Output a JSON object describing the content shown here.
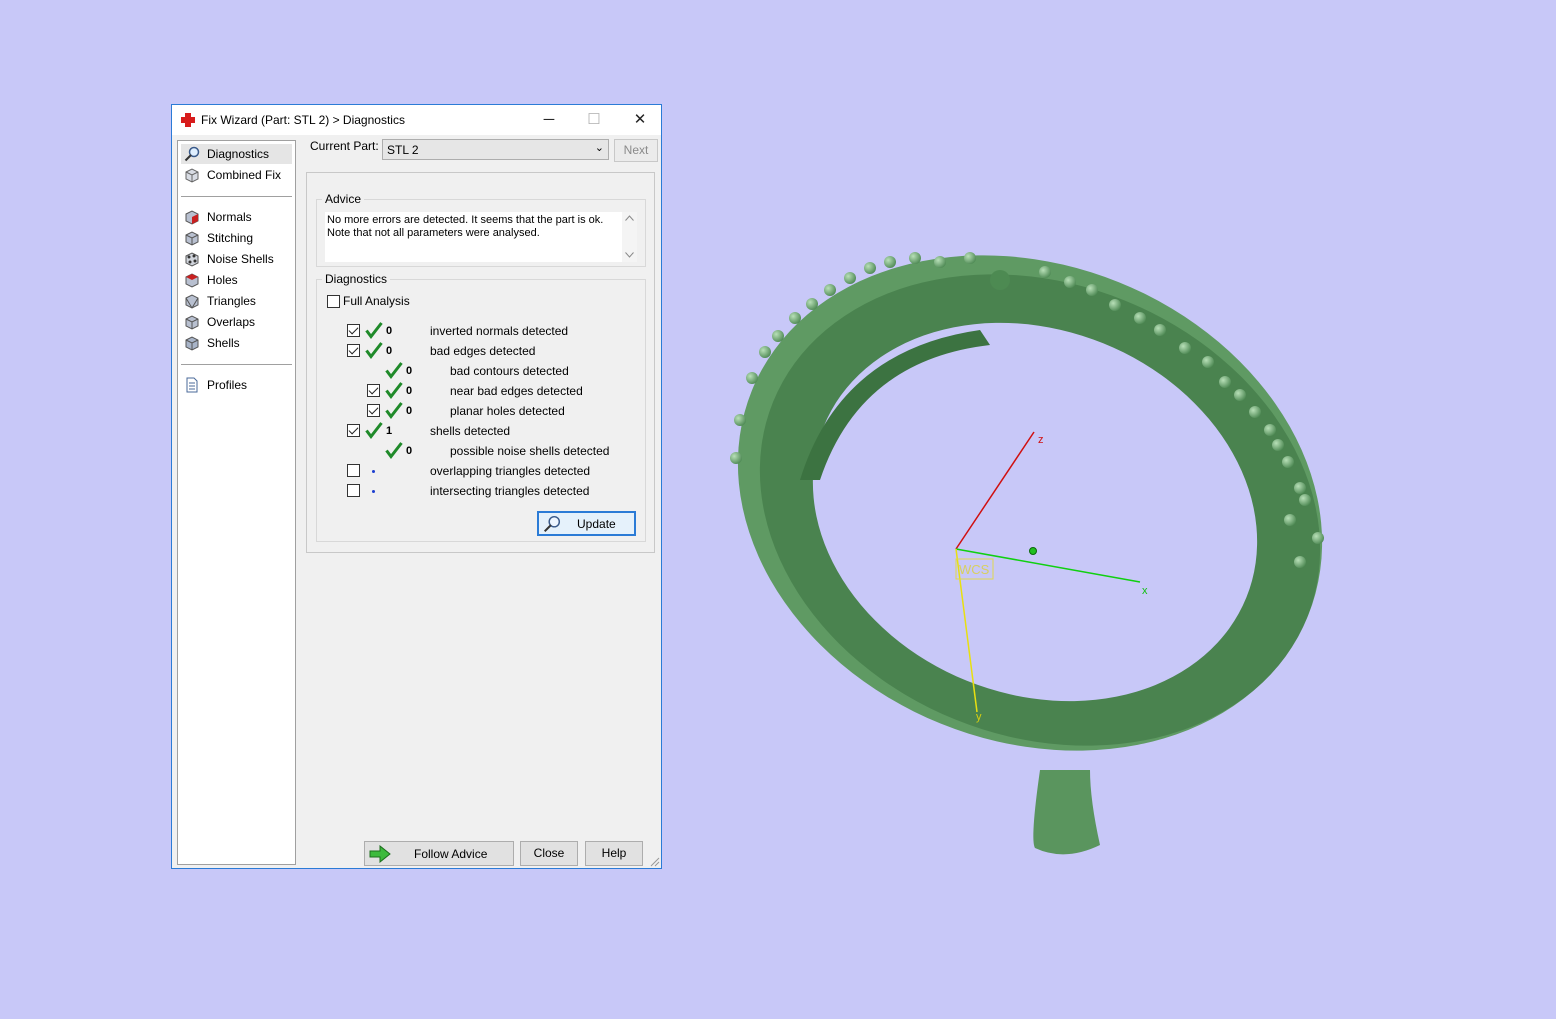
{
  "window": {
    "title": "Fix Wizard (Part: STL 2) > Diagnostics",
    "minimize": "─",
    "maximize": "☐",
    "close": "✕"
  },
  "nav": {
    "diagnostics": "Diagnostics",
    "combined_fix": "Combined Fix",
    "normals": "Normals",
    "stitching": "Stitching",
    "noise_shells": "Noise Shells",
    "holes": "Holes",
    "triangles": "Triangles",
    "overlaps": "Overlaps",
    "shells": "Shells",
    "profiles": "Profiles"
  },
  "current_part": {
    "label": "Current Part:",
    "value": "STL 2",
    "next_label": "Next"
  },
  "advice": {
    "title": "Advice",
    "text": "No more errors are detected. It seems that the part is ok. Note that not all parameters were analysed."
  },
  "diagnostics": {
    "title": "Diagnostics",
    "full_analysis": "Full Analysis",
    "update_label": "Update",
    "rows": {
      "inverted_normals": {
        "value": "0",
        "text": "inverted normals detected"
      },
      "bad_edges": {
        "value": "0",
        "text": "bad edges detected"
      },
      "bad_contours": {
        "value": "0",
        "text": "bad contours detected"
      },
      "near_bad_edges": {
        "value": "0",
        "text": "near bad edges detected"
      },
      "planar_holes": {
        "value": "0",
        "text": "planar holes detected"
      },
      "shells": {
        "value": "1",
        "text": "shells detected"
      },
      "noise_shells": {
        "value": "0",
        "text": "possible noise shells detected"
      },
      "overlapping": {
        "text": "overlapping triangles detected"
      },
      "intersecting": {
        "text": "intersecting triangles detected"
      }
    }
  },
  "footer": {
    "follow_advice": "Follow Advice",
    "close": "Close",
    "help": "Help"
  },
  "viewport": {
    "axis_z": "z",
    "axis_x": "x",
    "axis_y": "y",
    "wcs": "WCS"
  },
  "colors": {
    "background": "#c8c8f8",
    "model": "#5f9a63",
    "check_green": "#1f8a2a"
  }
}
